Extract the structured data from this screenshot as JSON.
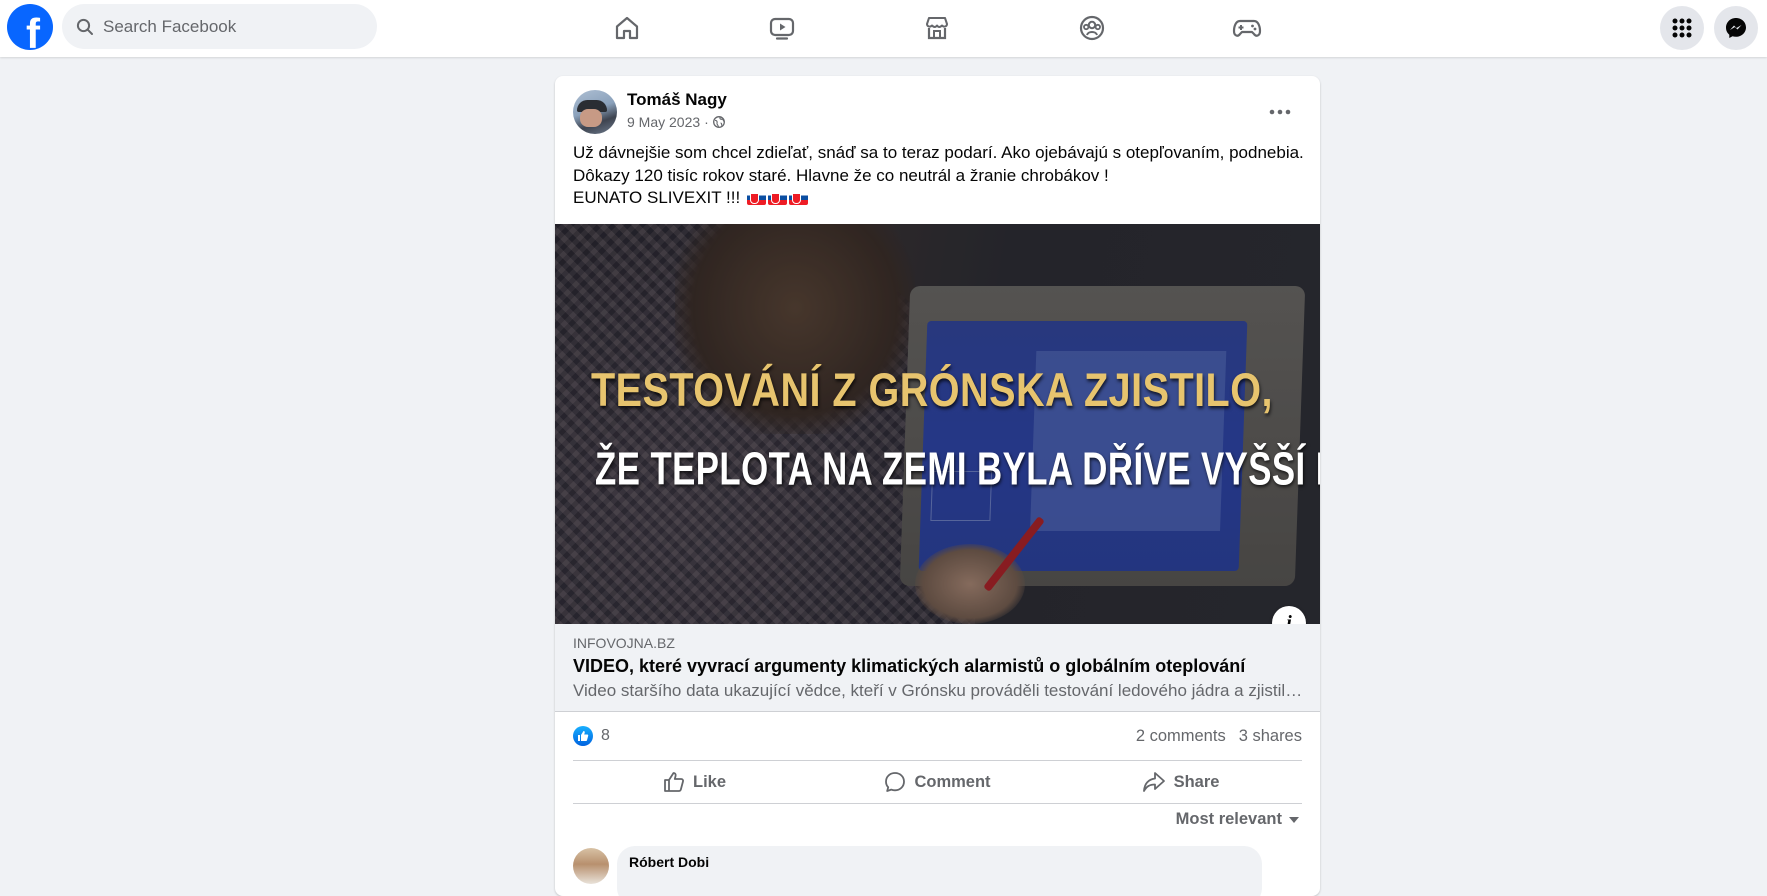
{
  "topbar": {
    "search_placeholder": "Search Facebook",
    "nav": [
      "home-icon",
      "video-icon",
      "marketplace-icon",
      "groups-icon",
      "gaming-icon"
    ],
    "right": [
      "menu-grid-icon",
      "messenger-icon"
    ],
    "brand_color": "#0866ff"
  },
  "post": {
    "author": "Tomáš Nagy",
    "date": "9 May 2023",
    "separator": "·",
    "audience_icon": "globe-icon",
    "text_lines": [
      "Už dávnejšie som chcel zdieľať, snáď sa to teraz podarí. Ako ojebávajú s otepľovaním, podnebia.",
      "Dôkazy 120 tisíc rokov staré. Hlavne že co neutrál a žranie chrobákov !",
      "EUNATO SLIVEXIT !!!"
    ],
    "flags": [
      "slovakia-flag",
      "slovakia-flag",
      "slovakia-flag"
    ],
    "preview": {
      "headline_line1": "TESTOVÁNÍ Z GRÓNSKA ZJISTILO,",
      "headline_line2": "ŽE TEPLOTA NA ZEMI BYLA DŘÍVE VYŠŠÍ NEŽ DNES",
      "domain": "INFOVOJNA.BZ",
      "title": "VIDEO, které vyvrací argumenty klimatických alarmistů o globálním oteplování",
      "description": "Video staršího data ukazující vědce, kteří v Grónsku prováděli testování ledového jádra a zjistili..."
    },
    "reactions_count": "8",
    "comments": "2 comments",
    "shares": "3 shares",
    "actions": {
      "like": "Like",
      "comment": "Comment",
      "share": "Share"
    },
    "sort_label": "Most relevant",
    "first_comment_author": "Róbert Dobi"
  }
}
